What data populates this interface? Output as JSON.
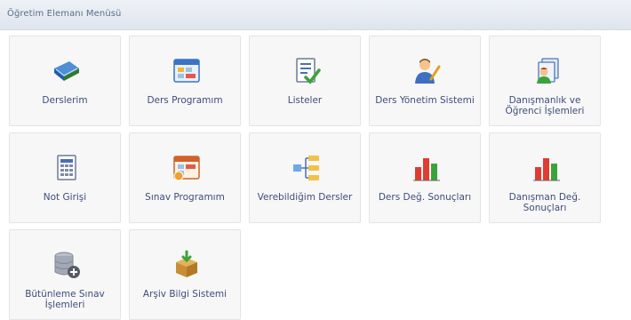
{
  "header": {
    "title": "Öğretim Elemanı Menüsü"
  },
  "tiles": [
    {
      "label": "Derslerim",
      "icon": "book-icon"
    },
    {
      "label": "Ders Programım",
      "icon": "calendar-window-icon"
    },
    {
      "label": "Listeler",
      "icon": "checklist-icon"
    },
    {
      "label": "Ders Yönetim Sistemi",
      "icon": "teacher-icon"
    },
    {
      "label": "Danışmanlık ve Öğrenci İşlemleri",
      "icon": "advisor-documents-icon"
    },
    {
      "label": "Not Girişi",
      "icon": "spreadsheet-icon"
    },
    {
      "label": "Sınav Programım",
      "icon": "exam-calendar-icon"
    },
    {
      "label": "Verebildiğim Dersler",
      "icon": "sitemap-icon"
    },
    {
      "label": "Ders Değ. Sonuçları",
      "icon": "bar-chart-icon"
    },
    {
      "label": "Danışman Değ. Sonuçları",
      "icon": "bar-chart-icon"
    },
    {
      "label": "Bütünleme Sınav İşlemleri",
      "icon": "database-add-icon"
    },
    {
      "label": "Arşiv Bilgi Sistemi",
      "icon": "archive-box-icon"
    }
  ]
}
